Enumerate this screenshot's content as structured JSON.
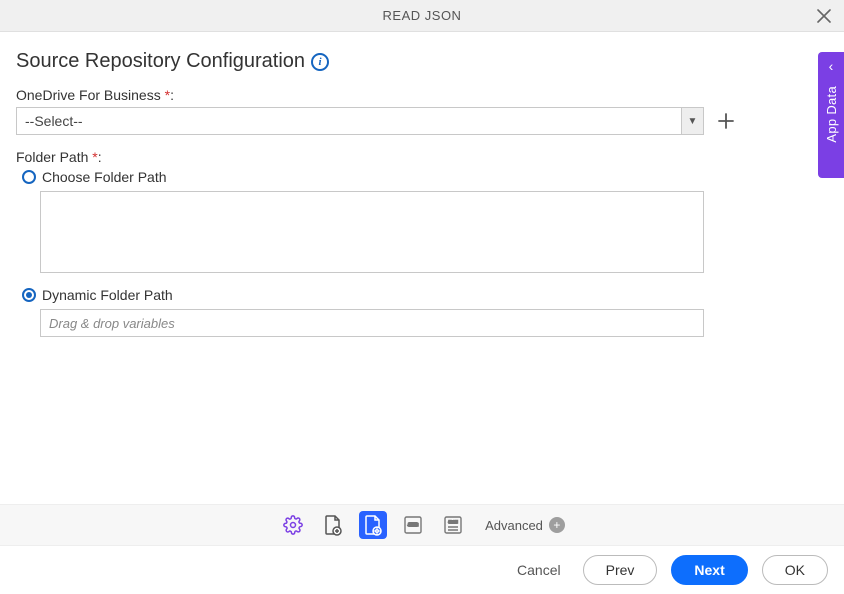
{
  "header": {
    "title": "READ JSON"
  },
  "section": {
    "title": "Source Repository Configuration"
  },
  "fields": {
    "onedrive": {
      "label": "OneDrive For Business",
      "required_mark": "*",
      "colon": ":",
      "selected": "--Select--"
    },
    "folderpath": {
      "label": "Folder Path",
      "required_mark": "*",
      "colon": ":",
      "choose_label": "Choose Folder Path",
      "dynamic_label": "Dynamic Folder Path",
      "dynamic_placeholder": "Drag & drop variables"
    }
  },
  "sidepanel": {
    "label": "App Data"
  },
  "toolbar": {
    "icons": {
      "settings": "settings-gear-icon",
      "page_add": "page-add-icon",
      "page_config": "page-config-icon",
      "json_doc": "json-doc-icon",
      "json_list": "json-list-icon"
    },
    "advanced_label": "Advanced"
  },
  "footer": {
    "cancel": "Cancel",
    "prev": "Prev",
    "next": "Next",
    "ok": "OK"
  }
}
